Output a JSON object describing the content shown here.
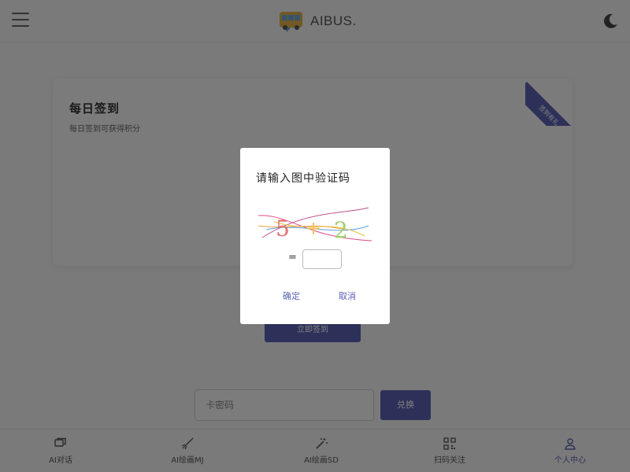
{
  "header": {
    "brand": "AIBUS.",
    "menu_icon": "hamburger-menu-icon",
    "theme_icon": "moon-icon"
  },
  "card": {
    "title": "每日签到",
    "subtitle": "每日签到可获得积分",
    "ribbon": "签到有礼",
    "image": "trophy-icon"
  },
  "background_button": "立即签到",
  "search": {
    "placeholder": "卡密码",
    "button": "兑换"
  },
  "tabs": [
    {
      "label": "AI对话",
      "icon": "chat-icon",
      "active": false
    },
    {
      "label": "AI绘画MJ",
      "icon": "brush-icon",
      "active": false
    },
    {
      "label": "AI绘画SD",
      "icon": "magic-wand-icon",
      "active": false
    },
    {
      "label": "扫码关注",
      "icon": "qrcode-icon",
      "active": false
    },
    {
      "label": "个人中心",
      "icon": "user-icon",
      "active": true
    }
  ],
  "modal": {
    "title": "请输入图中验证码",
    "captcha_text": "5 + 2",
    "equals": "=",
    "input_value": "",
    "confirm": "确定",
    "cancel": "取消"
  },
  "colors": {
    "accent": "#5b62b3",
    "background": "#f5f5f5"
  }
}
